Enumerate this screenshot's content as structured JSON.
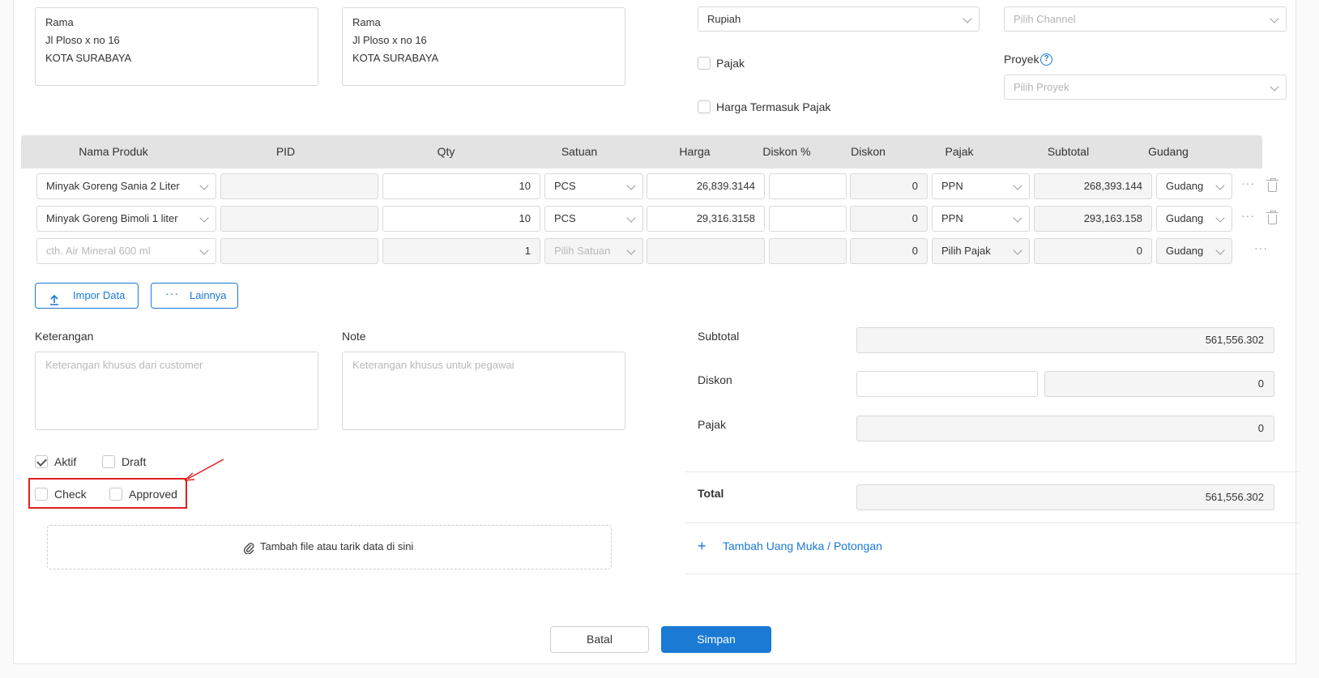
{
  "billing_address": {
    "name": "Rama",
    "street": "Jl Ploso x no 16",
    "city": "KOTA SURABAYA"
  },
  "shipping_address": {
    "name": "Rama",
    "street": "Jl Ploso x no 16",
    "city": "KOTA SURABAYA"
  },
  "currency": {
    "value": "Rupiah"
  },
  "channel": {
    "placeholder": "Pilih Channel"
  },
  "tax_options": {
    "pajak": "Pajak",
    "harga_termasuk_pajak": "Harga Termasuk Pajak"
  },
  "project": {
    "label": "Proyek",
    "placeholder": "Pilih Proyek"
  },
  "table": {
    "headers": [
      "Nama Produk",
      "PID",
      "Qty",
      "Satuan",
      "Harga",
      "Diskon %",
      "Diskon",
      "Pajak",
      "Subtotal",
      "Gudang"
    ],
    "rows": [
      {
        "product": "Minyak Goreng Sania 2 Liter",
        "pid": "",
        "qty": "10",
        "unit": "PCS",
        "price": "26,839.3144",
        "disc_pct": "",
        "disc": "0",
        "tax": "PPN",
        "subtotal": "268,393.144",
        "warehouse": "Gudang"
      },
      {
        "product": "Minyak Goreng Bimoli 1 liter",
        "pid": "",
        "qty": "10",
        "unit": "PCS",
        "price": "29,316.3158",
        "disc_pct": "",
        "disc": "0",
        "tax": "PPN",
        "subtotal": "293,163.158",
        "warehouse": "Gudang"
      },
      {
        "product": "cth. Air Mineral 600 ml",
        "pid": "",
        "qty": "1",
        "unit": "Pilih Satuan",
        "price": "",
        "disc_pct": "",
        "disc": "0",
        "tax": "Pilih Pajak",
        "subtotal": "0",
        "warehouse": "Gudang"
      }
    ]
  },
  "actions": {
    "import": "Impor Data",
    "more": "Lainnya"
  },
  "keterangan": {
    "label": "Keterangan",
    "placeholder": "Keterangan khusus dari customer"
  },
  "note": {
    "label": "Note",
    "placeholder": "Keterangan khusus untuk pegawai"
  },
  "status": {
    "aktif": "Aktif",
    "draft": "Draft",
    "check": "Check",
    "approved": "Approved"
  },
  "attachment": {
    "label": "Tambah file atau tarik data di sini"
  },
  "summary": {
    "subtotal_label": "Subtotal",
    "subtotal_value": "561,556.302",
    "diskon_label": "Diskon",
    "diskon_value": "0",
    "pajak_label": "Pajak",
    "pajak_value": "0",
    "total_label": "Total",
    "total_value": "561,556.302"
  },
  "add_down_payment": "Tambah Uang Muka / Potongan",
  "footer": {
    "cancel": "Batal",
    "save": "Simpan"
  },
  "colors": {
    "primary": "#1a7ad4",
    "highlight": "#e02020"
  }
}
